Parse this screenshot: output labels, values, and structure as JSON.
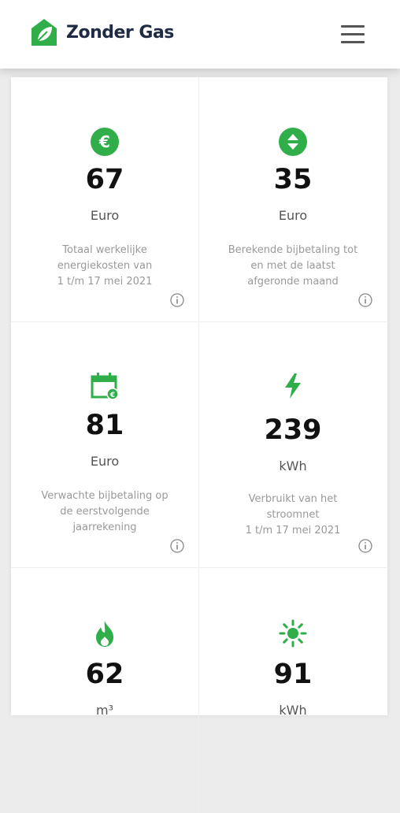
{
  "header": {
    "brand": "Zonder Gas",
    "logo_icon": "house-leaf-icon",
    "menu_icon": "hamburger-menu-icon"
  },
  "colors": {
    "accent": "#2fae4a",
    "text": "#111111",
    "muted": "#999999"
  },
  "cards": [
    {
      "icon": "euro-icon",
      "value": "67",
      "unit": "Euro",
      "desc_lines": [
        "Totaal werkelijke",
        "energiekosten van",
        "1 t/m   17 mei 2021"
      ]
    },
    {
      "icon": "up-down-arrows-icon",
      "value": "35",
      "unit": "Euro",
      "desc_lines": [
        "Berekende bijbetaling tot",
        "en met de laatst",
        "afgeronde maand"
      ]
    },
    {
      "icon": "calendar-euro-icon",
      "value": "81",
      "unit": "Euro",
      "desc_lines": [
        "Verwachte bijbetaling op",
        "de eerstvolgende",
        "jaarrekening"
      ]
    },
    {
      "icon": "lightning-icon",
      "value": "239",
      "unit": "kWh",
      "desc_lines": [
        "Verbruikt van het",
        "stroomnet",
        "1 t/m   17 mei 2021"
      ]
    },
    {
      "icon": "flame-icon",
      "value": "62",
      "unit": "m³",
      "desc_lines": []
    },
    {
      "icon": "sun-icon",
      "value": "91",
      "unit": "kWh",
      "desc_lines": []
    }
  ]
}
